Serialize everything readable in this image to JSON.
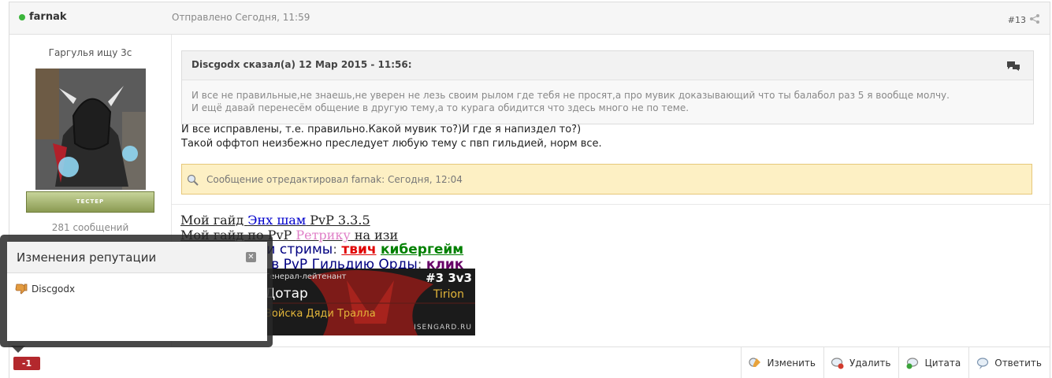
{
  "post": {
    "author": "farnak",
    "sent": "Отправлено Сегодня, 11:59",
    "number": "#13",
    "user_title": "Гаргулья ищу 3с",
    "badge": "B",
    "group_badge": "ТЕСТЕР",
    "message_count": "281 сообщений"
  },
  "quote": {
    "header": "Discgodx сказал(а) 12 Мар 2015 - 11:56:",
    "line1": "И все не правильные,не знаешь,не уверен не лезь своим рылом где тебя не просят,а про мувик доказывающий что ты балабол раз 5 я вообще молчу.",
    "line2": "И ещё давай перенесём общение в другую тему,а то курага обидится что здесь много не по теме."
  },
  "message": {
    "line1": "И все исправлены, т.е. правильно.Какой мувик то?)И где я напиздел то?)",
    "line2": "Такой оффтоп неизбежно преследует любую тему с пвп гильдией, норм все."
  },
  "edited": "Сообщение отредактировал farnak: Сегодня, 12:04",
  "signature": {
    "l1_a": "Мой гайд ",
    "l1_link": "Энх шам",
    "l1_b": " PvP 3.3.5",
    "l2_a": "Мой гайд по PvP ",
    "l2_link": "Ретрику",
    "l2_b": " на изи",
    "l3_a": "ои стримы",
    "l3_colon": ": ",
    "l3_twitch": "твич",
    "l3_cyber": "кибергейм",
    "l4_a": "р в PvP Гильдию Орды",
    "l4_colon": ": ",
    "l4_link": "клик"
  },
  "banner": {
    "rank": "Генерал-лейтенант",
    "rating": "#3 3v3",
    "name": "Дотар",
    "realm": "Tirion",
    "guild": "Войска Дяди Тралла",
    "site": "ISENGARD.RU"
  },
  "footer": {
    "reputation": "-1",
    "edit": "Изменить",
    "delete": "Удалить",
    "quote": "Цитата",
    "reply": "Ответить"
  },
  "popup": {
    "title": "Изменения репутации",
    "close": "✕",
    "user": "Discgodx"
  },
  "colors": {
    "online": "#3bb53b",
    "reputation_negative": "#b3282d",
    "edited_bg": "#fdf0c4",
    "link_blue": "#0000cc",
    "link_pink": "#e080c8",
    "twitch_red": "#e00000",
    "cyber_green": "#008000",
    "click_purple": "#660066"
  }
}
